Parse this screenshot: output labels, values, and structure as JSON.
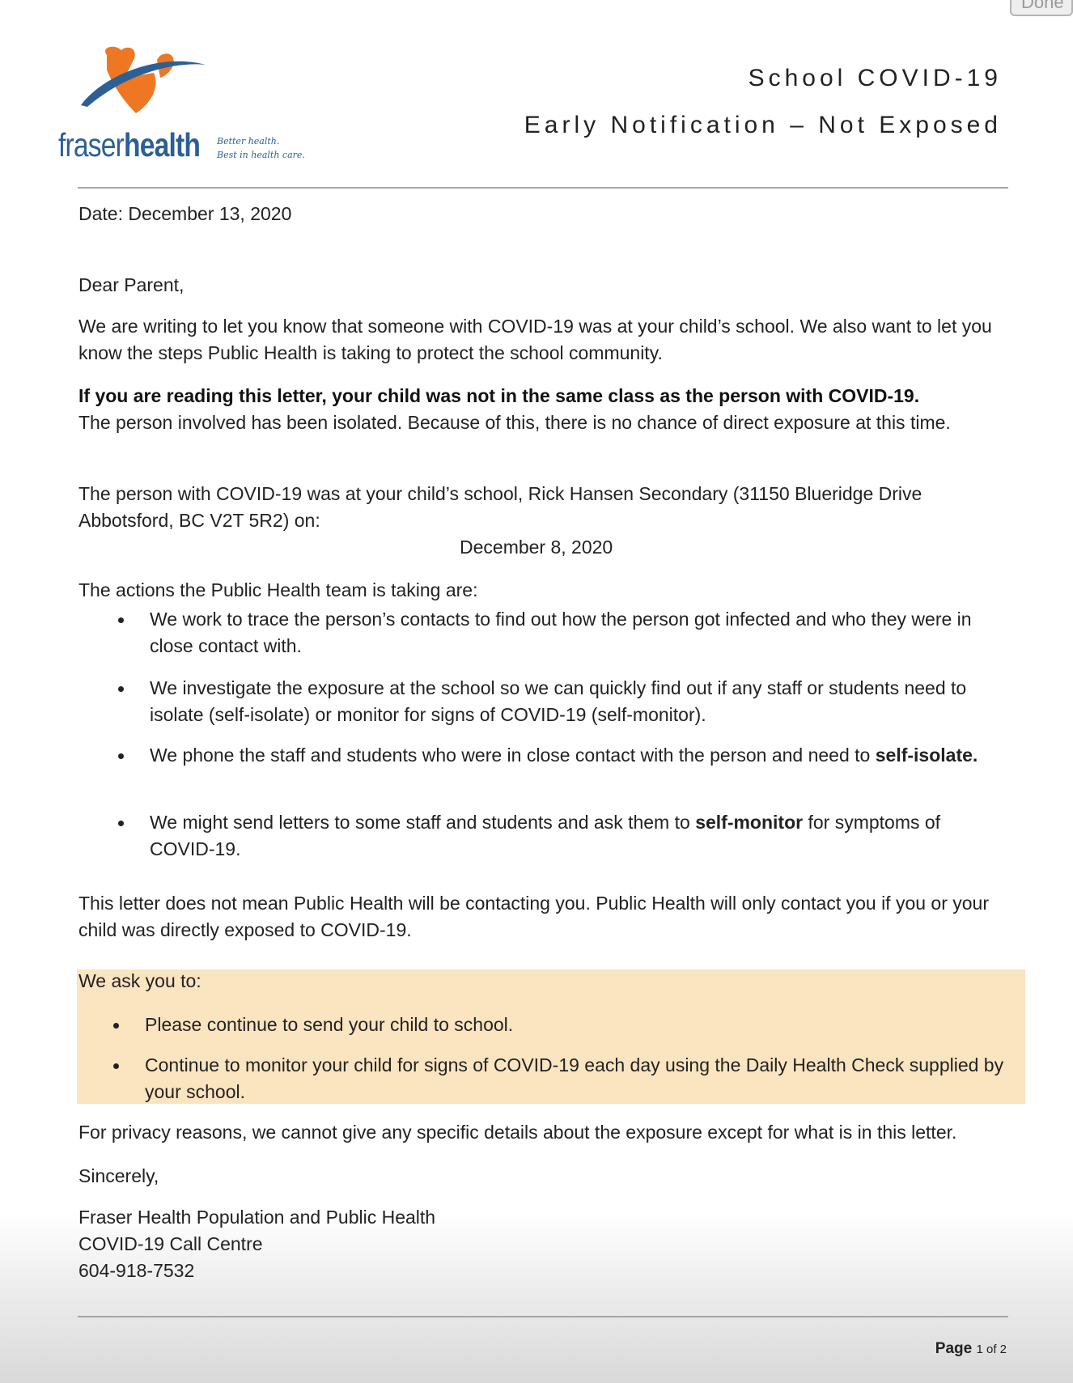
{
  "ui": {
    "done_label": "Done"
  },
  "logo": {
    "word_light": "fraser",
    "word_bold": "health",
    "tagline_1": "Better health.",
    "tagline_2": "Best in health care.",
    "colors": {
      "orange": "#ef7622",
      "blue": "#2c5f96"
    }
  },
  "header": {
    "title_1": "School COVID-19",
    "title_2": "Early Notification – Not Exposed"
  },
  "letter": {
    "date": "Date: December 13, 2020",
    "greeting": "Dear Parent,",
    "para1": "We are writing to let you know that someone with COVID-19 was at your child’s school. We also want to let you know the steps Public Health is taking to protect the school community.",
    "para2_bold": "If you are reading this letter, your child was not in the same class as the person with COVID-19.",
    "para2_rest": "The person involved has been isolated. Because of this, there is no chance of direct exposure at this time.",
    "para3": "The person with COVID-19 was at your child’s school, Rick Hansen Secondary (31150 Blueridge Drive Abbotsford, BC V2T 5R2) on:",
    "exposure_date": "December 8, 2020",
    "actions_intro": "The actions the Public Health team is taking are:",
    "actions": {
      "a1": "We work to trace the person’s contacts to find out how the person got infected and who they were in close contact with.",
      "a2": "We investigate the exposure at the school so we can quickly find out if any staff or students need to isolate (self-isolate) or monitor for signs of COVID-19 (self-monitor).",
      "a3_pre": "We phone the staff and students who were in close contact with the person and need to ",
      "a3_bold": "self-isolate.",
      "a4_pre": "We might send letters to some staff and students and ask them to ",
      "a4_bold": "self-monitor",
      "a4_post": " for symptoms of COVID-19."
    },
    "para4": "This letter does not mean Public Health will be contacting you. Public Health will only contact you if you or your child was directly exposed to COVID-19.",
    "ask_intro": "We ask you to:",
    "ask": {
      "q1": "Please continue to send your child to school.",
      "q2": "Continue to monitor your child for signs of COVID-19 each day using the Daily Health Check supplied by your school."
    },
    "privacy": "For privacy reasons, we cannot give any specific details about the exposure except for what is in this letter.",
    "closing": "Sincerely,",
    "sig_1": "Fraser Health Population and Public Health",
    "sig_2": "COVID-19 Call Centre",
    "sig_3": "604-918-7532"
  },
  "footer": {
    "page_word": "Page",
    "page_rest": "1 of 2"
  },
  "colors": {
    "highlight": "#fbe4c0",
    "rule": "#a6a6a6"
  }
}
